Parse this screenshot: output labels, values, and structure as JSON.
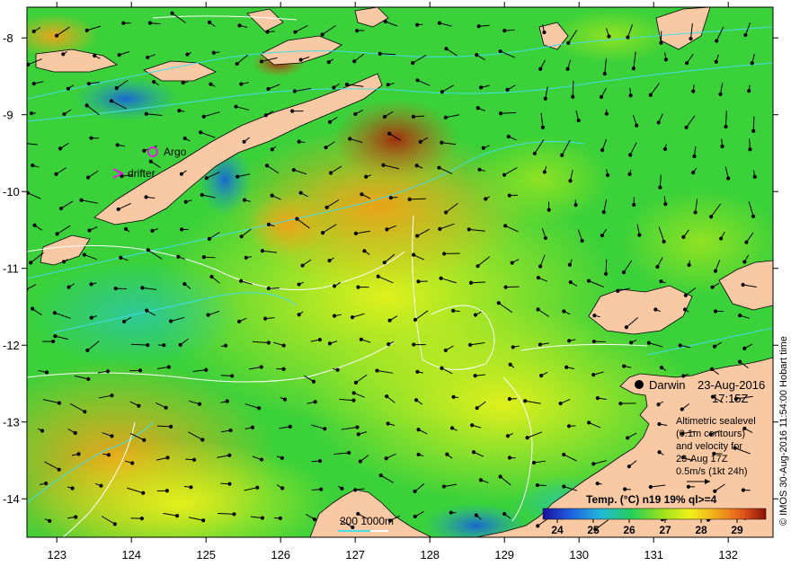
{
  "map": {
    "lon_ticks": [
      "123",
      "124",
      "125",
      "126",
      "127",
      "128",
      "129",
      "130",
      "131",
      "132"
    ],
    "lat_ticks": [
      "-8",
      "-9",
      "-10",
      "-11",
      "-12",
      "-13",
      "-14"
    ],
    "lon_range": [
      122.6,
      132.6
    ],
    "lat_range": [
      -14.5,
      -7.6
    ]
  },
  "markers": {
    "argo_label": "Argo",
    "drifter_label": "drifter",
    "argo_color": "#e020e0",
    "drifter_color": "#e020e0"
  },
  "info": {
    "location": "Darwin",
    "date": "23-Aug-2016",
    "time": "17:15Z",
    "legend_lines": [
      "Altimetric sealevel",
      "(0.1m contours)",
      "and velocity for",
      "23-Aug 17Z",
      "0.5m/s (1kt 24h)"
    ]
  },
  "scale_bar": {
    "label": "200  1000m"
  },
  "colorbar": {
    "title": "Temp. (°C) n19 19% ql>=4",
    "ticks": [
      "24",
      "25",
      "26",
      "27",
      "28",
      "29"
    ],
    "range": [
      23.6,
      29.8
    ]
  },
  "credit": "© IMOS 30-Aug-2016 11:54:00 Hobart time",
  "colors": {
    "land": "#f9c9a4",
    "ocean_base": "#3ad13a",
    "contour_cyan": "#44dde8",
    "contour_white": "#ffffff"
  }
}
